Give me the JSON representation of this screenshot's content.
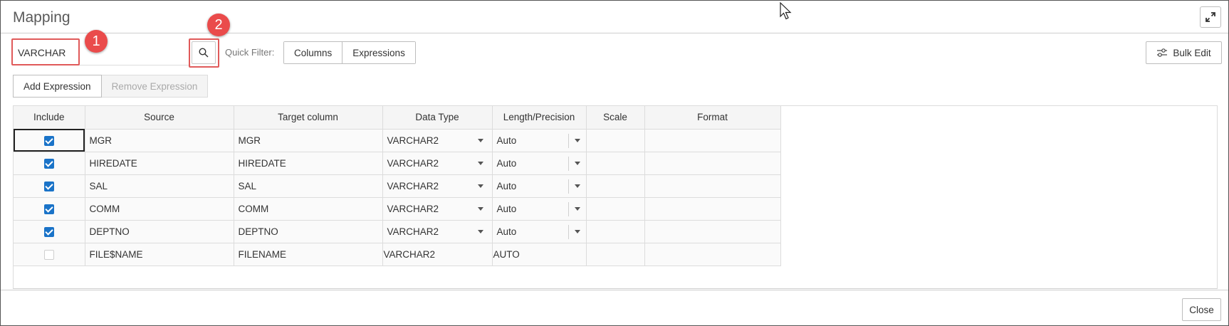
{
  "dialog": {
    "title": "Mapping"
  },
  "search": {
    "value": "VARCHAR",
    "placeholder": ""
  },
  "badges": {
    "one": "1",
    "two": "2"
  },
  "quick_filter": {
    "label": "Quick Filter:",
    "options": [
      "Columns",
      "Expressions"
    ]
  },
  "toolbar": {
    "bulk_edit_label": "Bulk Edit",
    "add_expression_label": "Add Expression",
    "remove_expression_label": "Remove Expression"
  },
  "grid": {
    "columns": [
      "Include",
      "Source",
      "Target column",
      "Data Type",
      "Length/Precision",
      "Scale",
      "Format"
    ],
    "rows": [
      {
        "include": true,
        "source": "MGR",
        "target": "MGR",
        "data_type": "VARCHAR2",
        "length": "Auto",
        "editable": true
      },
      {
        "include": true,
        "source": "HIREDATE",
        "target": "HIREDATE",
        "data_type": "VARCHAR2",
        "length": "Auto",
        "editable": true
      },
      {
        "include": true,
        "source": "SAL",
        "target": "SAL",
        "data_type": "VARCHAR2",
        "length": "Auto",
        "editable": true
      },
      {
        "include": true,
        "source": "COMM",
        "target": "COMM",
        "data_type": "VARCHAR2",
        "length": "Auto",
        "editable": true
      },
      {
        "include": true,
        "source": "DEPTNO",
        "target": "DEPTNO",
        "data_type": "VARCHAR2",
        "length": "Auto",
        "editable": true
      },
      {
        "include": false,
        "source": "FILE$NAME",
        "target": "FILENAME",
        "data_type": "VARCHAR2",
        "length": "AUTO",
        "editable": false
      }
    ]
  },
  "footer": {
    "close_label": "Close"
  },
  "colors": {
    "accent": "#1a73c8",
    "highlight": "#e05a5a",
    "badge": "#ea4b4b"
  }
}
